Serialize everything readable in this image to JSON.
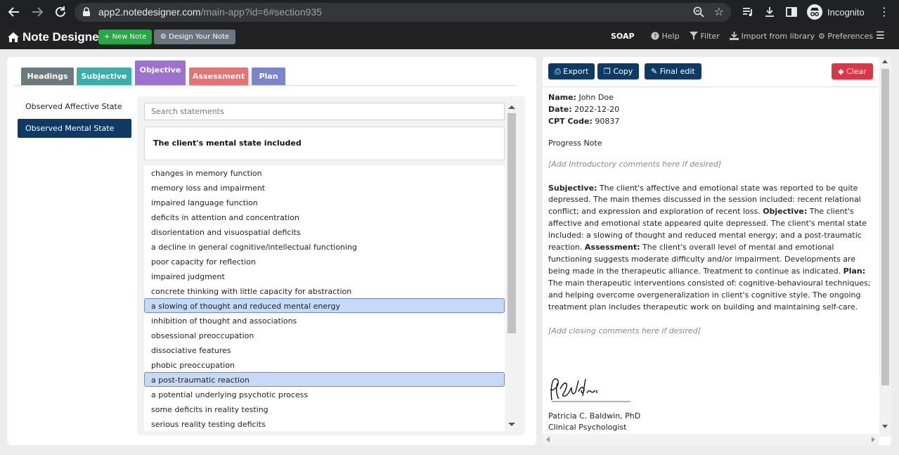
{
  "browser": {
    "url_host": "app2.notedesigner.com",
    "url_path": "/main-app?id=6#section935",
    "profile_label": "Incognito",
    "icons": [
      "back-arrow-icon",
      "forward-arrow-icon",
      "reload-icon",
      "lock-icon",
      "zoom-icon",
      "star-icon",
      "media-control-icon",
      "download-icon",
      "sidepanel-icon",
      "incognito-icon",
      "kebab-menu-icon"
    ]
  },
  "app": {
    "brand": "Note Designer",
    "new_note": "New Note",
    "design_note": "Design Your Note",
    "nav": {
      "soap": "SOAP",
      "help": "Help",
      "filter": "Filter",
      "import": "Import from library",
      "preferences": "Preferences"
    }
  },
  "tabs": [
    {
      "label": "Headings",
      "color": "#6c7a80"
    },
    {
      "label": "Subjective",
      "color": "#3aafa9"
    },
    {
      "label": "Objective",
      "color": "#9b72cf"
    },
    {
      "label": "Assessment",
      "color": "#e57373"
    },
    {
      "label": "Plan",
      "color": "#7986cb"
    }
  ],
  "active_tab": "Objective",
  "categories": [
    {
      "label": "Observed Affective State",
      "active": false
    },
    {
      "label": "Observed Mental State",
      "active": true
    }
  ],
  "search": {
    "placeholder": "Search statements"
  },
  "statement_header": "The client's mental state included",
  "statements": [
    {
      "text": "changes in memory function",
      "selected": false
    },
    {
      "text": "memory loss and impairment",
      "selected": false
    },
    {
      "text": "impaired language function",
      "selected": false
    },
    {
      "text": "deficits in attention and concentration",
      "selected": false
    },
    {
      "text": "disorientation and visuospatial deficits",
      "selected": false
    },
    {
      "text": "a decline in general cognitive/intellectual functioning",
      "selected": false
    },
    {
      "text": "poor capacity for reflection",
      "selected": false
    },
    {
      "text": "impaired judgment",
      "selected": false
    },
    {
      "text": "concrete thinking with little capacity for abstraction",
      "selected": false
    },
    {
      "text": "a slowing of thought and reduced mental energy",
      "selected": true
    },
    {
      "text": "inhibition of thought and associations",
      "selected": false
    },
    {
      "text": "obsessional preoccupation",
      "selected": false
    },
    {
      "text": "dissociative features",
      "selected": false
    },
    {
      "text": "phobic preoccupation",
      "selected": false
    },
    {
      "text": "a post-traumatic reaction",
      "selected": true
    },
    {
      "text": "a potential underlying psychotic process",
      "selected": false
    },
    {
      "text": "some deficits in reality testing",
      "selected": false
    },
    {
      "text": "serious reality testing deficits",
      "selected": false
    }
  ],
  "actions": {
    "export": "Export",
    "copy": "Copy",
    "final_edit": "Final edit",
    "clear": "Clear"
  },
  "note": {
    "name_label": "Name:",
    "name": "John Doe",
    "date_label": "Date:",
    "date": "2022-12-20",
    "cpt_label": "CPT Code:",
    "cpt": "90837",
    "title": "Progress Note",
    "intro_placeholder": "[Add Introductory comments here if desired]",
    "subjective_label": "Subjective:",
    "subjective_text": "The client's affective and emotional state was reported to be quite depressed. The main themes discussed in the session included: recent relational conflict; and expression and exploration of recent loss.",
    "objective_label": "Objective:",
    "objective_text": "The client's affective and emotional state appeared quite depressed. The client's mental state included: a slowing of thought and reduced mental energy; and a post-traumatic reaction.",
    "assessment_label": "Assessment:",
    "assessment_text": "The client's overall level of mental and emotional functioning suggests moderate difficulty and/or impairment. Developments are being made in the therapeutic alliance. Treatment to continue as indicated.",
    "plan_label": "Plan:",
    "plan_text": "The main therapeutic interventions consisted of: cognitive-behavioural techniques; and helping overcome overgeneralization in client's cognitive style. The ongoing treatment plan includes therapeutic work on building and maintaining self-care.",
    "closing_placeholder": "[Add closing comments here if desired]",
    "signer_name": "Patricia C. Baldwin, PhD",
    "signer_title": "Clinical Psychologist"
  }
}
